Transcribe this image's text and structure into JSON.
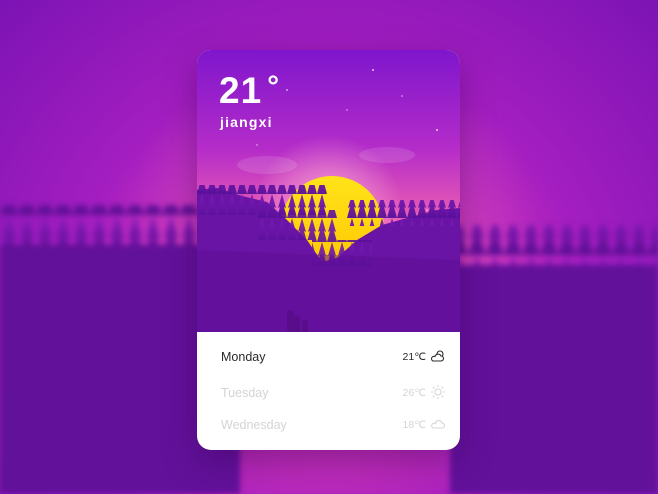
{
  "weather": {
    "current_temperature": "21",
    "degree_symbol": "°",
    "city": "jiangxi"
  },
  "forecast": [
    {
      "day": "Monday",
      "temperature": "21℃",
      "icon": "partly-cloudy-icon",
      "active": true
    },
    {
      "day": "Tuesday",
      "temperature": "26℃",
      "icon": "sun-icon",
      "active": false
    },
    {
      "day": "Wednesday",
      "temperature": "18℃",
      "icon": "cloud-icon",
      "active": false
    }
  ],
  "colors": {
    "sky_top": "#8a1fcf",
    "sky_bottom": "#f06aa8",
    "sun": "#ffd400",
    "forest": "#6d15a4",
    "accent": "#5a0d8a"
  }
}
